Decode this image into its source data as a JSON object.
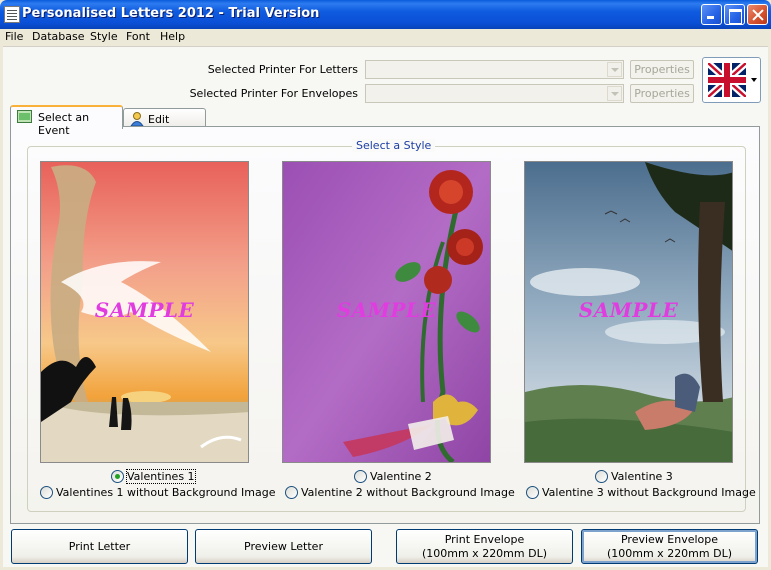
{
  "window": {
    "title": "Personalised Letters 2012 - Trial Version"
  },
  "menu": [
    "File",
    "Database",
    "Style",
    "Font",
    "Help"
  ],
  "printers": {
    "letters_label": "Selected Printer For Letters",
    "envelopes_label": "Selected Printer For Envelopes",
    "letters_value": "",
    "envelopes_value": "",
    "properties_label": "Properties"
  },
  "language": {
    "flag": "uk-flag-icon"
  },
  "tabs": [
    {
      "label": "Select an Event",
      "icon": "event-list-icon",
      "active": true
    },
    {
      "label": "Edit Details",
      "icon": "user-edit-icon",
      "active": false
    }
  ],
  "style_group": {
    "title": "Select a Style",
    "watermark": "SAMPLE",
    "styles": [
      {
        "label": "Valentines 1",
        "alt_label": "Valentines 1 without Background Image",
        "selected": true
      },
      {
        "label": "Valentine 2",
        "alt_label": "Valentine 2 without Background Image",
        "selected": false
      },
      {
        "label": "Valentine 3",
        "alt_label": "Valentine 3 without Background Image",
        "selected": false
      }
    ]
  },
  "buttons": {
    "print_letter": "Print Letter",
    "preview_letter": "Preview Letter",
    "print_envelope_line1": "Print Envelope",
    "print_envelope_line2": "(100mm x 220mm DL)",
    "preview_envelope_line1": "Preview Envelope",
    "preview_envelope_line2": "(100mm x 220mm DL)"
  },
  "colors": {
    "titlebar": "#0A4FD6",
    "accent_tab": "#F9B13A",
    "sample_text": "#E03CE0",
    "group_title": "#1C3DA6"
  }
}
